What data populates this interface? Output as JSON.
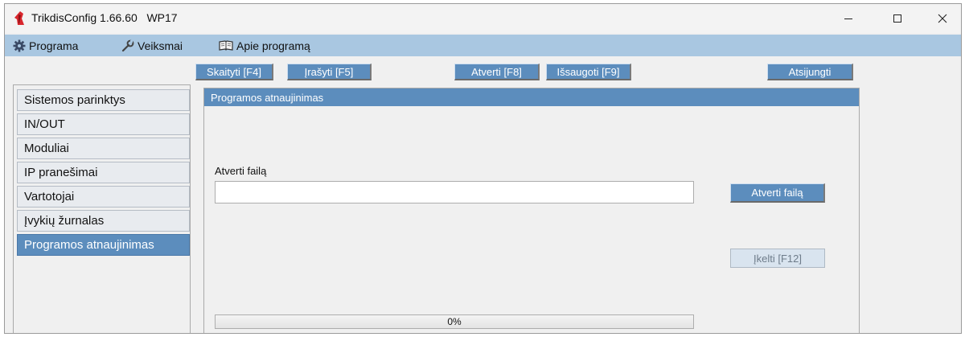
{
  "window": {
    "title": "TrikdisConfig 1.66.60   WP17",
    "icon": "trikdis-app-icon",
    "controls": [
      "minimize-icon",
      "maximize-icon",
      "close-icon"
    ]
  },
  "menu": [
    {
      "label": "Programa",
      "icon": "gear-icon"
    },
    {
      "label": "Veiksmai",
      "icon": "wrench-icon"
    },
    {
      "label": "Apie programą",
      "icon": "book-icon"
    }
  ],
  "toolbar": {
    "read": "Skaityti [F4]",
    "write": "Įrašyti [F5]",
    "open": "Atverti [F8]",
    "save": "Išsaugoti [F9]",
    "disconnect": "Atsijungti"
  },
  "sidebar": {
    "items": [
      {
        "label": "Sistemos parinktys",
        "active": false
      },
      {
        "label": "IN/OUT",
        "active": false
      },
      {
        "label": "Moduliai",
        "active": false
      },
      {
        "label": "IP pranešimai",
        "active": false
      },
      {
        "label": "Vartotojai",
        "active": false
      },
      {
        "label": "Įvykių žurnalas",
        "active": false
      },
      {
        "label": "Programos atnaujinimas",
        "active": true
      }
    ]
  },
  "panel": {
    "title": "Programos atnaujinimas",
    "file_label": "Atverti failą",
    "file_value": "",
    "open_button": "Atverti failą",
    "upload_button": "Įkelti [F12]",
    "progress_text": "0%",
    "progress_value": 0
  },
  "colors": {
    "accent": "#5c8dbd",
    "menubar": "#a9c7e1",
    "panel_bg": "#f0f0f0"
  }
}
